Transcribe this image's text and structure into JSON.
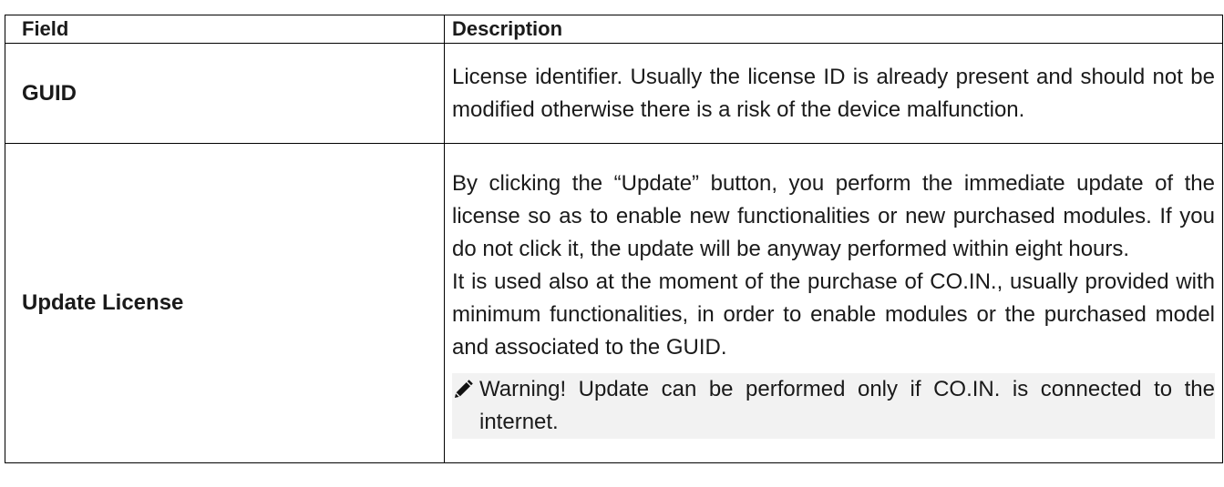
{
  "table": {
    "headers": {
      "field": "Field",
      "description": "Description"
    },
    "rows": [
      {
        "field": "GUID",
        "description": "License identifier. Usually the license ID is already present and should not be modified otherwise there is a risk of the device malfunction."
      },
      {
        "field": "Update License",
        "description_p1": "By clicking the “Update” button, you perform the immediate update of the license so as to enable new functionalities or new purchased modules. If you do not click it, the update will be anyway performed within eight hours.",
        "description_p2": "It is used also at the moment of the purchase of CO.IN., usually provided with minimum functionalities, in order to enable modules or the purchased model and associated to the GUID.",
        "warning": "Warning! Update can be performed only if CO.IN. is connected to the internet.",
        "warning_icon": "pencil-icon"
      }
    ]
  }
}
